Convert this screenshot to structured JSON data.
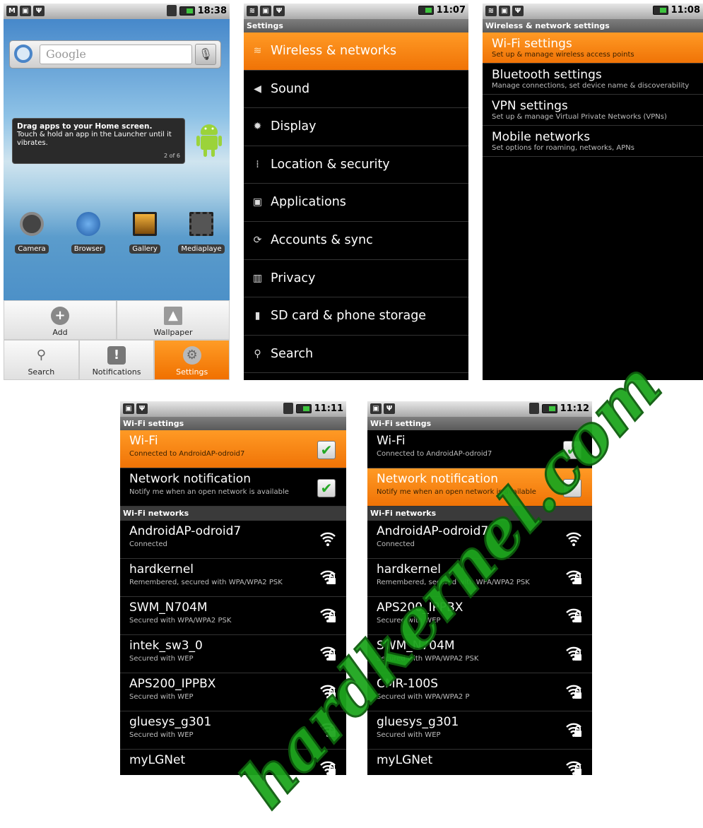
{
  "screen1": {
    "status_time": "18:38",
    "search_placeholder": "Google",
    "tooltip": {
      "title": "Drag apps to your Home screen.",
      "body": "Touch & hold an app in the Launcher until it vibrates.",
      "page": "2 of 6"
    },
    "apps": [
      {
        "label": "Camera",
        "icon": "camera-icon",
        "color": "#444444"
      },
      {
        "label": "Browser",
        "icon": "globe-icon",
        "color": "#2a6db5"
      },
      {
        "label": "Gallery",
        "icon": "gallery-icon",
        "color": "#c7901e"
      },
      {
        "label": "Mediaplaye",
        "icon": "film-icon",
        "color": "#555555"
      }
    ],
    "tray": {
      "add": "Add",
      "wallpaper": "Wallpaper",
      "search": "Search",
      "notifications": "Notifications",
      "settings": "Settings"
    }
  },
  "screen2": {
    "status_time": "11:07",
    "title": "Settings",
    "items": [
      {
        "label": "Wireless & networks",
        "icon": "wifi-icon",
        "glyph": "≋"
      },
      {
        "label": "Sound",
        "icon": "speaker-icon",
        "glyph": "◀"
      },
      {
        "label": "Display",
        "icon": "brightness-icon",
        "glyph": "✹"
      },
      {
        "label": "Location & security",
        "icon": "grid-icon",
        "glyph": "⁞"
      },
      {
        "label": "Applications",
        "icon": "applications-icon",
        "glyph": "▣"
      },
      {
        "label": "Accounts & sync",
        "icon": "sync-icon",
        "glyph": "⟳"
      },
      {
        "label": "Privacy",
        "icon": "privacy-icon",
        "glyph": "▥"
      },
      {
        "label": "SD card & phone storage",
        "icon": "sdcard-icon",
        "glyph": "▮"
      },
      {
        "label": "Search",
        "icon": "search-icon",
        "glyph": "⚲"
      }
    ]
  },
  "screen3": {
    "status_time": "11:08",
    "title": "Wireless & network settings",
    "items": [
      {
        "label": "Wi-Fi settings",
        "sub": "Set up & manage wireless access points"
      },
      {
        "label": "Bluetooth settings",
        "sub": "Manage connections, set device name & discoverability"
      },
      {
        "label": "VPN settings",
        "sub": "Set up & manage Virtual Private Networks (VPNs)"
      },
      {
        "label": "Mobile networks",
        "sub": "Set options for roaming, networks, APNs"
      }
    ]
  },
  "screen4": {
    "status_time": "11:11",
    "title": "Wi-Fi settings",
    "wifi": {
      "label": "Wi-Fi",
      "sub": "Connected to AndroidAP-odroid7",
      "checked": true
    },
    "notification": {
      "label": "Network notification",
      "sub": "Notify me when an open network is available",
      "checked": true
    },
    "section": "Wi-Fi networks",
    "networks": [
      {
        "name": "AndroidAP-odroid7",
        "sub": "Connected",
        "secured": false
      },
      {
        "name": "hardkernel",
        "sub": "Remembered, secured with WPA/WPA2 PSK",
        "secured": true
      },
      {
        "name": "SWM_N704M",
        "sub": "Secured with WPA/WPA2 PSK",
        "secured": true
      },
      {
        "name": "intek_sw3_0",
        "sub": "Secured with WEP",
        "secured": true
      },
      {
        "name": "APS200_IPPBX",
        "sub": "Secured with WEP",
        "secured": true
      },
      {
        "name": "gluesys_g301",
        "sub": "Secured with WEP",
        "secured": true
      },
      {
        "name": "myLGNet",
        "sub": "",
        "secured": true
      }
    ]
  },
  "screen5": {
    "status_time": "11:12",
    "title": "Wi-Fi settings",
    "wifi": {
      "label": "Wi-Fi",
      "sub": "Connected to AndroidAP-odroid7",
      "checked": true
    },
    "notification": {
      "label": "Network notification",
      "sub": "Notify me when an open network is available",
      "checked": true
    },
    "section": "Wi-Fi networks",
    "networks": [
      {
        "name": "AndroidAP-odroid7",
        "sub": "Connected",
        "secured": false
      },
      {
        "name": "hardkernel",
        "sub": "Remembered, secured with WPA/WPA2 PSK",
        "secured": true
      },
      {
        "name": "APS200_IPPBX",
        "sub": "Secured with WEP",
        "secured": true
      },
      {
        "name": "SWM_N704M",
        "sub": "Secured with WPA/WPA2 PSK",
        "secured": true
      },
      {
        "name": "CMR-100S",
        "sub": "Secured with WPA/WPA2 P",
        "secured": true
      },
      {
        "name": "gluesys_g301",
        "sub": "Secured with WEP",
        "secured": true
      },
      {
        "name": "myLGNet",
        "sub": "",
        "secured": true
      }
    ]
  },
  "watermark": "hardkernel.com",
  "colors": {
    "accent_orange": "#f78a12",
    "check_green": "#25a825",
    "watermark_green": "#1ea61e"
  }
}
